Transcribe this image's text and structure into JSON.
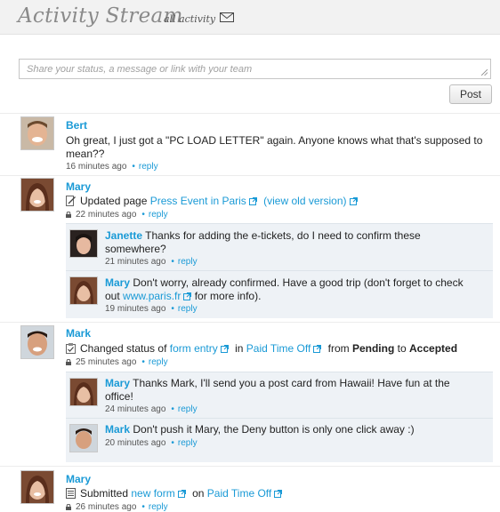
{
  "header": {
    "title": "Activity Stream",
    "filter_label": "all activity"
  },
  "composer": {
    "placeholder": "Share your status, a message or link with your team",
    "post_label": "Post"
  },
  "reply_label": "reply",
  "entries": [
    {
      "author": "Bert",
      "text_line1": "Oh great, I just got a \"PC LOAD LETTER\" again. Anyone knows what that's supposed to",
      "text_line2": "mean??",
      "time": "16 minutes ago"
    },
    {
      "author": "Mary",
      "action": "Updated page",
      "link1": "Press Event in Paris",
      "link2": "(view old version)",
      "time": "22 minutes ago",
      "comments": [
        {
          "author": "Janette",
          "text_line1": "Thanks for adding the e-tickets, do I need to confirm these",
          "text_line2": "somewhere?",
          "time": "21 minutes ago"
        },
        {
          "author": "Mary",
          "text_line1": "Don't worry, already confirmed. Have a good trip (don't forget to check",
          "text_line2_pre": "out",
          "text_line2_link": "www.paris.fr",
          "text_line2_post": "for more info).",
          "time": "19 minutes ago"
        }
      ]
    },
    {
      "author": "Mark",
      "action": "Changed status of",
      "link1": "form entry",
      "in_word": "in",
      "link2": "Paid Time Off",
      "from_word": "from",
      "from_value": "Pending",
      "to_word": "to",
      "to_value": "Accepted",
      "time": "25 minutes ago",
      "comments": [
        {
          "author": "Mary",
          "text_line1": "Thanks Mark, I'll send you a post card from Hawaii! Have fun at the",
          "text_line2": "office!",
          "time": "24 minutes ago"
        },
        {
          "author": "Mark",
          "text_line1": "Don't push it Mary, the Deny button is only one click away :)",
          "time": "20 minutes ago"
        }
      ]
    },
    {
      "author": "Mary",
      "action": "Submitted",
      "link1": "new form",
      "on_word": "on",
      "link2": "Paid Time Off",
      "time": "26 minutes ago"
    }
  ],
  "colors": {
    "link": "#1a9ad6",
    "comment_bg": "#eef2f6",
    "header_bg": "#f2f2f2"
  }
}
